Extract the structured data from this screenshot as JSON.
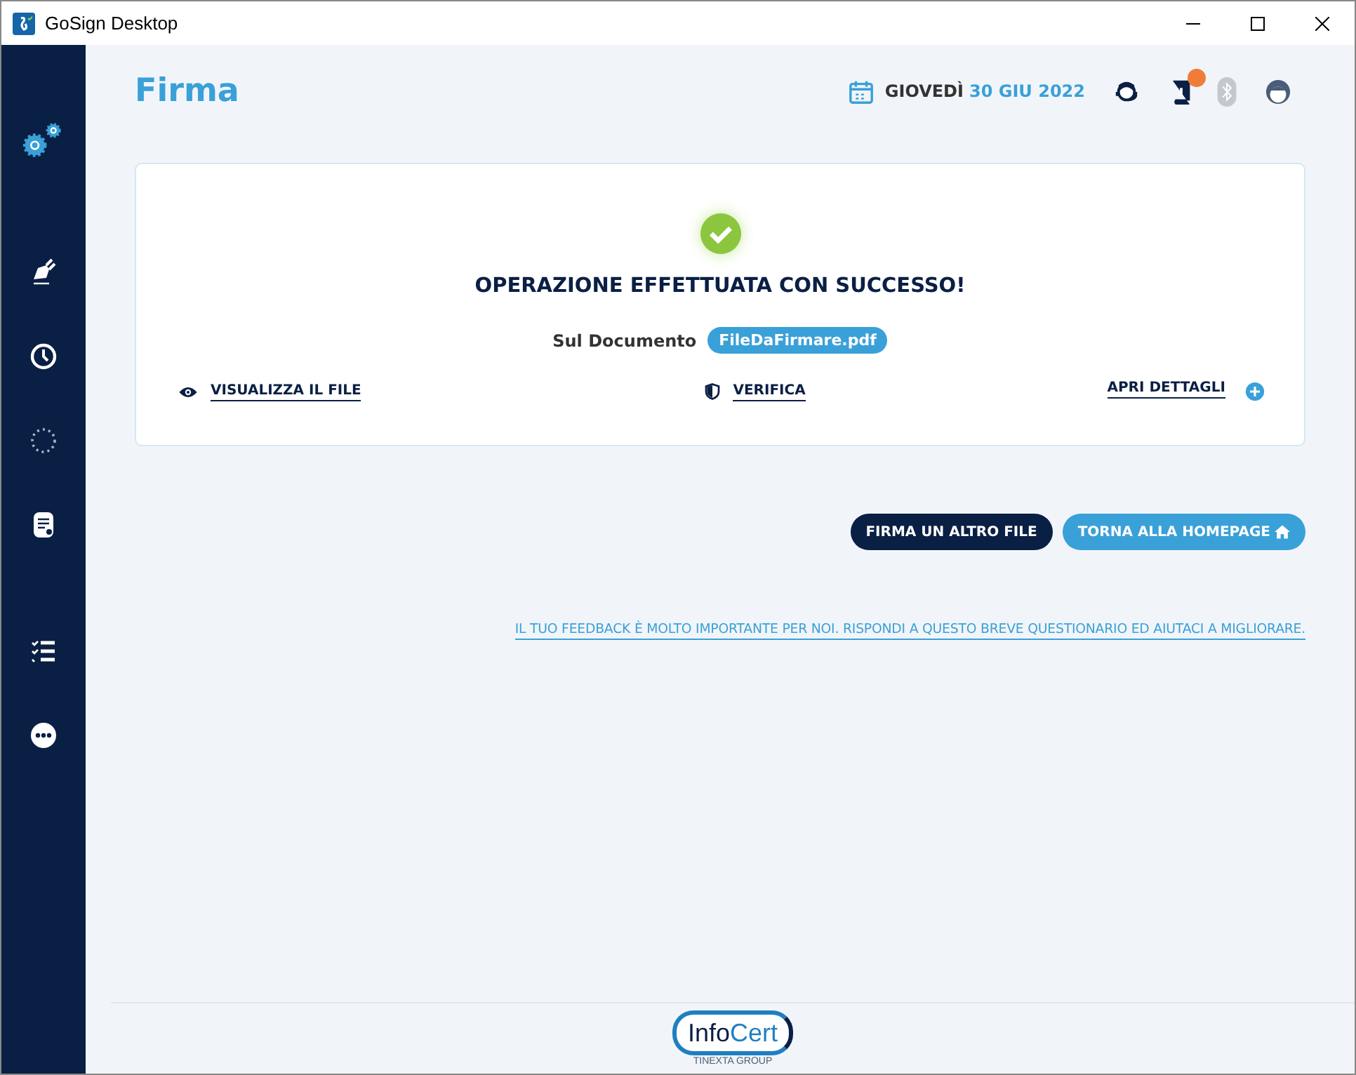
{
  "window": {
    "title": "GoSign Desktop"
  },
  "header": {
    "title": "Firma",
    "day": "GIOVEDÌ",
    "date": "30 GIU 2022",
    "notification_badge": true,
    "bluetooth_disabled": true
  },
  "result": {
    "message": "OPERAZIONE EFFETTUATA CON SUCCESSO!",
    "document_label": "Sul Documento",
    "file_name": "FileDaFirmare.pdf",
    "links": [
      {
        "kind": "view",
        "label": "VISUALIZZA IL FILE"
      },
      {
        "kind": "verify",
        "label": "VERIFICA"
      },
      {
        "kind": "details",
        "label": "APRI DETTAGLI"
      }
    ]
  },
  "buttons": [
    {
      "kind": "dark",
      "label": "FIRMA UN ALTRO FILE"
    },
    {
      "kind": "home",
      "label": "TORNA ALLA HOMEPAGE"
    }
  ],
  "feedback_link": "IL TUO FEEDBACK È MOLTO IMPORTANTE PER NOI. RISPONDI A QUESTO BREVE QUESTIONARIO ED AIUTACI A MIGLIORARE.",
  "footer": {
    "logo": [
      "Info",
      "Cert"
    ],
    "tagline": "TINEXTA GROUP"
  }
}
